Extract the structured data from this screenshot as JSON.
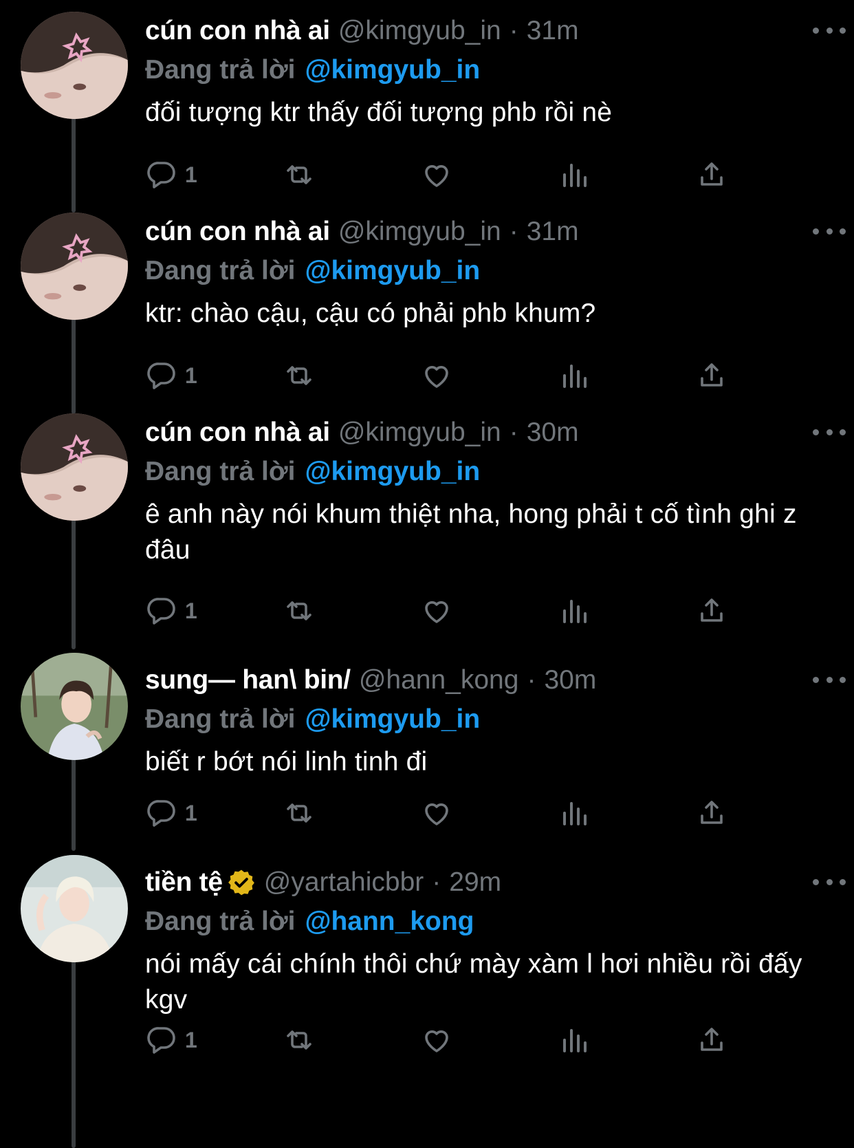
{
  "reply_label": "Đang trả lời",
  "tweets": [
    {
      "name": "cún con nhà ai",
      "handle": "@kimgyub_in",
      "time": "31m",
      "reply_to": "@kimgyub_in",
      "text": "đối tượng ktr thấy đối tượng phb rồi nè",
      "reply_count": "1",
      "verified": false,
      "avatar": "avatar-kimgyub"
    },
    {
      "name": "cún con nhà ai",
      "handle": "@kimgyub_in",
      "time": "31m",
      "reply_to": "@kimgyub_in",
      "text": "ktr: chào cậu, cậu có phải phb khum?",
      "reply_count": "1",
      "verified": false,
      "avatar": "avatar-kimgyub"
    },
    {
      "name": "cún con nhà ai",
      "handle": "@kimgyub_in",
      "time": "30m",
      "reply_to": "@kimgyub_in",
      "text": "ê anh này nói khum thiệt nha, hong phải t cố tình ghi z đâu",
      "reply_count": "1",
      "verified": false,
      "avatar": "avatar-kimgyub"
    },
    {
      "name": "sung— han\\ bin/",
      "handle": "@hann_kong",
      "time": "30m",
      "reply_to": "@kimgyub_in",
      "text": "biết r bớt nói linh tinh đi",
      "reply_count": "1",
      "verified": false,
      "avatar": "avatar-hannkong"
    },
    {
      "name": "tiền tệ",
      "handle": "@yartahicbbr",
      "time": "29m",
      "reply_to": "@hann_kong",
      "text": "nói mấy cái chính thôi chứ mày xàm l hơi nhiều rồi đấy kgv",
      "reply_count": "1",
      "verified": true,
      "avatar": "avatar-yartahicbbr"
    }
  ],
  "colors": {
    "background": "#000000",
    "text": "#ffffff",
    "muted": "#71767b",
    "link": "#1d9bf0",
    "verified_badge": "#e2b719",
    "thread_line": "#3a3d40"
  },
  "icons": [
    "reply-icon",
    "retweet-icon",
    "like-icon",
    "views-icon",
    "share-icon",
    "more-icon",
    "verified-badge-icon"
  ]
}
